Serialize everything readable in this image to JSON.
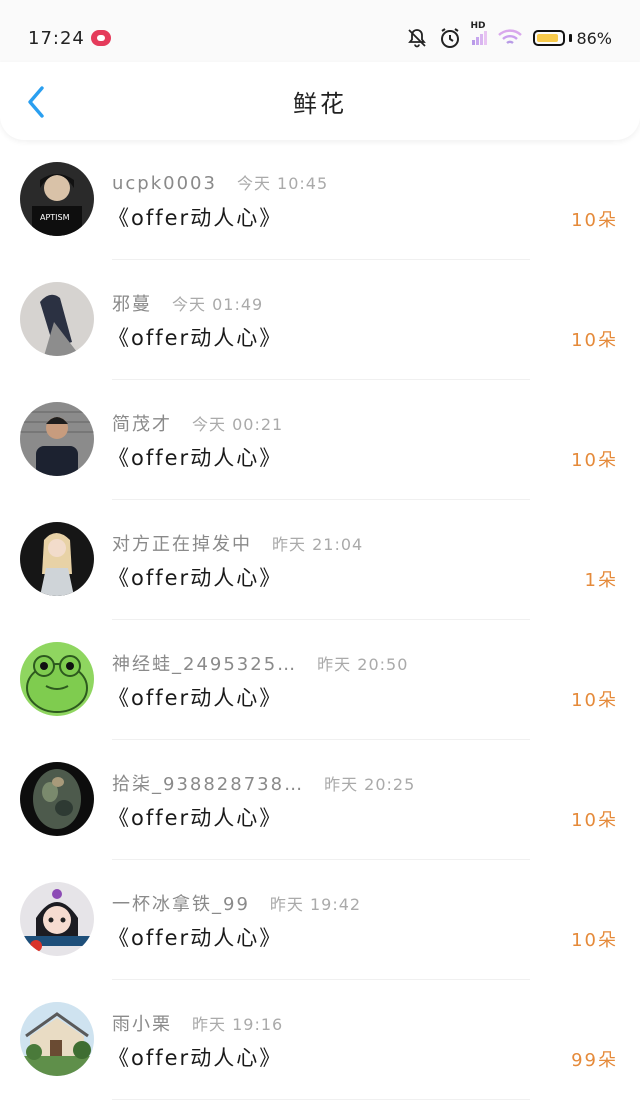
{
  "status": {
    "time": "17:24",
    "network": "HD",
    "battery": "86%",
    "battery_level": 0.86
  },
  "header": {
    "title": "鲜花"
  },
  "items": [
    {
      "name": "ucpk0003",
      "time": "今天 10:45",
      "message": "《offer动人心》",
      "count": "10朵"
    },
    {
      "name": "邪蔓",
      "time": "今天 01:49",
      "message": "《offer动人心》",
      "count": "10朵"
    },
    {
      "name": "简茂才",
      "time": "今天 00:21",
      "message": "《offer动人心》",
      "count": "10朵"
    },
    {
      "name": "对方正在掉发中",
      "time": "昨天 21:04",
      "message": "《offer动人心》",
      "count": "1朵"
    },
    {
      "name": "神经蛙_2495325…",
      "time": "昨天 20:50",
      "message": "《offer动人心》",
      "count": "10朵"
    },
    {
      "name": "拾柒_938828738…",
      "time": "昨天 20:25",
      "message": "《offer动人心》",
      "count": "10朵"
    },
    {
      "name": "一杯冰拿铁_99",
      "time": "昨天 19:42",
      "message": "《offer动人心》",
      "count": "10朵"
    },
    {
      "name": "雨小栗",
      "time": "昨天 19:16",
      "message": "《offer动人心》",
      "count": "99朵"
    }
  ]
}
